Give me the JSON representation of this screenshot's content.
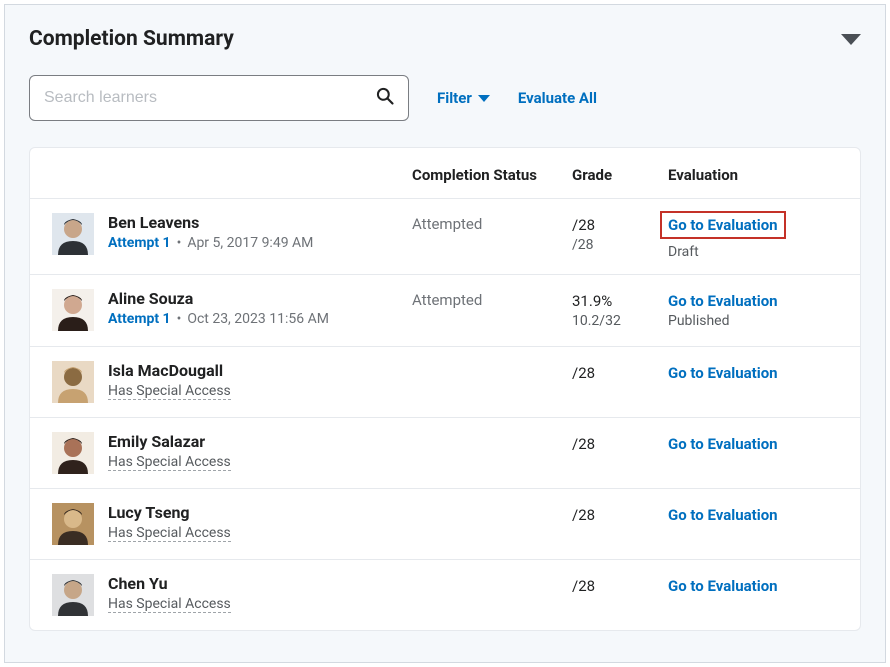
{
  "header": {
    "title": "Completion Summary"
  },
  "toolbar": {
    "search_placeholder": "Search learners",
    "filter_label": "Filter",
    "evaluate_all_label": "Evaluate All"
  },
  "table": {
    "headers": {
      "status": "Completion Status",
      "grade": "Grade",
      "evaluation": "Evaluation"
    }
  },
  "learners": [
    {
      "name": "Ben Leavens",
      "avatar_colors": [
        "#dfe6ed",
        "#2d3136",
        "#c8a68a"
      ],
      "attempt_label": "Attempt 1",
      "attempt_date": "Apr 5, 2017 9:49 AM",
      "special_access": null,
      "status": "Attempted",
      "grade_primary": "/28",
      "grade_secondary": "/28",
      "eval_link": "Go to Evaluation",
      "eval_status": "Draft",
      "highlighted": true
    },
    {
      "name": "Aline Souza",
      "avatar_colors": [
        "#f4f0eb",
        "#2a1e19",
        "#d0a890"
      ],
      "attempt_label": "Attempt 1",
      "attempt_date": "Oct 23, 2023 11:56 AM",
      "special_access": null,
      "status": "Attempted",
      "grade_primary": "31.9%",
      "grade_secondary": "10.2/32",
      "eval_link": "Go to Evaluation",
      "eval_status": "Published",
      "highlighted": false
    },
    {
      "name": "Isla MacDougall",
      "avatar_colors": [
        "#e9d9c4",
        "#c7a271",
        "#8b6b42"
      ],
      "attempt_label": null,
      "attempt_date": null,
      "special_access": "Has Special Access",
      "status": "",
      "grade_primary": "/28",
      "grade_secondary": null,
      "eval_link": "Go to Evaluation",
      "eval_status": null,
      "highlighted": false
    },
    {
      "name": "Emily Salazar",
      "avatar_colors": [
        "#f2ece3",
        "#2f221c",
        "#a97258"
      ],
      "attempt_label": null,
      "attempt_date": null,
      "special_access": "Has Special Access",
      "status": "",
      "grade_primary": "/28",
      "grade_secondary": null,
      "eval_link": "Go to Evaluation",
      "eval_status": null,
      "highlighted": false
    },
    {
      "name": "Lucy Tseng",
      "avatar_colors": [
        "#b79261",
        "#3a2d23",
        "#d9b98a"
      ],
      "attempt_label": null,
      "attempt_date": null,
      "special_access": "Has Special Access",
      "status": "",
      "grade_primary": "/28",
      "grade_secondary": null,
      "eval_link": "Go to Evaluation",
      "eval_status": null,
      "highlighted": false
    },
    {
      "name": "Chen Yu",
      "avatar_colors": [
        "#dedfe1",
        "#313336",
        "#c6a688"
      ],
      "attempt_label": null,
      "attempt_date": null,
      "special_access": "Has Special Access",
      "status": "",
      "grade_primary": "/28",
      "grade_secondary": null,
      "eval_link": "Go to Evaluation",
      "eval_status": null,
      "highlighted": false
    }
  ]
}
